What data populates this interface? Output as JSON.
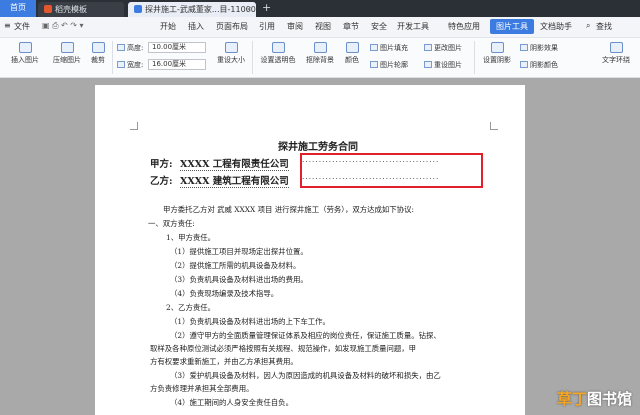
{
  "tabs": {
    "home": "首页",
    "template": "稻壳模板",
    "document": "探井施工-武威董家...目-110000元"
  },
  "menu": {
    "file": "文件",
    "items": [
      "开始",
      "插入",
      "页面布局",
      "引用",
      "审阅",
      "视图",
      "章节",
      "安全",
      "开发工具",
      "特色应用",
      "图片工具",
      "文档助手"
    ],
    "search": "查找"
  },
  "ribbon": {
    "insert_picture": "插入图片",
    "compress_picture": "压缩图片",
    "crop": "裁剪",
    "height_label": "高度:",
    "height_value": "10.00厘米",
    "width_label": "宽度:",
    "width_value": "16.00厘米",
    "reset_size": "重设大小",
    "color_picker": "设置透明色",
    "remove_bg": "抠除背景",
    "color": "颜色",
    "picture_fill": "图片填充",
    "picture_outline": "图片轮廓",
    "change_picture": "更改图片",
    "reset_picture": "重设图片",
    "set_shadow": "设置阴影",
    "effect": "阴影效果",
    "shadow_color": "阴影颜色",
    "text_wrap": "文字环绕"
  },
  "document": {
    "title": "探井施工劳务合同",
    "party_a_label": "甲方:",
    "party_a": "XXXX 工程有限责任公司",
    "party_b_label": "乙方:",
    "party_b": "XXXX 建筑工程有限公司",
    "intro": "甲方委托乙方对 武威 XXXX 项目 进行探井施工（劳务），双方达成如下协议:",
    "s1": "一、双方责任:",
    "s1_1": "1、甲方责任。",
    "l1": "（1）提供施工项目并现场定出探井位置。",
    "l2": "（2）提供施工所需的机具设备及材料。",
    "l3": "（3）负责机具设备及材料进出场的费用。",
    "l4": "（4）负责现场编录及技术指导。",
    "s1_2": "2、乙方责任。",
    "m1": "（1）负责机具设备及材料进出场的上下车工作。",
    "m2a": "（2）遵守甲方的全面质量管理保证体系及相应的岗位责任，保证施工质量。钻探、",
    "m2b": "取样及各种原位测试必须严格按照有关规程、规范操作，如发现施工质量问题，甲",
    "m2c": "方有权要求重新施工，并由乙方承担其费用。",
    "m3a": "（3）爱护机具设备及材料，因人为原因造成的机具设备及材料的破坏和损失，由乙",
    "m3b": "方负责修理并承担其全部费用。",
    "m4": "（4）施工期间的人身安全责任自负。"
  },
  "watermark": {
    "part1": "草丁",
    "part2": "图书馆"
  }
}
